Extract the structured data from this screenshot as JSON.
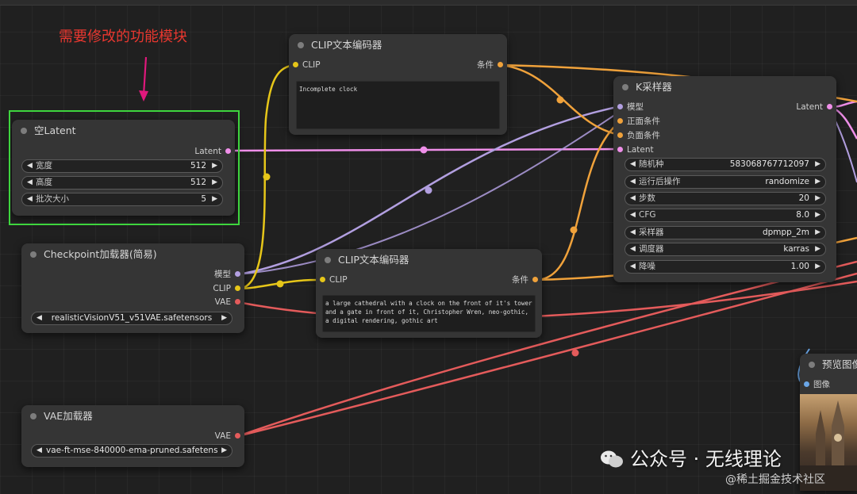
{
  "annotation": {
    "text": "需要修改的功能模块"
  },
  "colors": {
    "clip_wire": "#e6c619",
    "conditioning_wire": "#f0a23b",
    "model_wire": "#b29fe0",
    "latent_wire": "#ef8fe9",
    "vae_wire": "#e45b5b",
    "image_wire": "#6ba7e8",
    "annotation_red": "#e8372f",
    "annotation_green": "#3ed53e"
  },
  "nodes": {
    "empty_latent": {
      "title": "空Latent",
      "output_latent": "Latent",
      "widgets": [
        {
          "label": "宽度",
          "value": "512"
        },
        {
          "label": "高度",
          "value": "512"
        },
        {
          "label": "批次大小",
          "value": "5"
        }
      ]
    },
    "checkpoint": {
      "title": "Checkpoint加载器(简易)",
      "outputs": [
        "模型",
        "CLIP",
        "VAE"
      ],
      "ckpt_value": "realisticVisionV51_v51VAE.safetensors"
    },
    "clip_top": {
      "title": "CLIP文本编码器",
      "input": "CLIP",
      "output": "条件",
      "text": "Incomplete clock"
    },
    "clip_bottom": {
      "title": "CLIP文本编码器",
      "input": "CLIP",
      "output": "条件",
      "text": "a large cathedral with a clock on the front of it's tower and a gate in front of it, Christopher Wren, neo-gothic, a digital rendering, gothic art"
    },
    "ksampler": {
      "title": "K采样器",
      "inputs": [
        "模型",
        "正面条件",
        "负面条件",
        "Latent"
      ],
      "output": "Latent",
      "widgets": [
        {
          "label": "随机种",
          "value": "583068767712097"
        },
        {
          "label": "运行后操作",
          "value": "randomize"
        },
        {
          "label": "步数",
          "value": "20"
        },
        {
          "label": "CFG",
          "value": "8.0"
        },
        {
          "label": "采样器",
          "value": "dpmpp_2m"
        },
        {
          "label": "调度器",
          "value": "karras"
        },
        {
          "label": "降噪",
          "value": "1.00"
        }
      ]
    },
    "vae_loader": {
      "title": "VAE加载器",
      "output": "VAE",
      "vae_value": "vae-ft-mse-840000-ema-pruned.safetensors"
    },
    "preview": {
      "title": "预览图像",
      "input": "图像"
    }
  },
  "watermark": {
    "text": "公众号 · 无线理论",
    "credit": "@稀土掘金技术社区"
  }
}
